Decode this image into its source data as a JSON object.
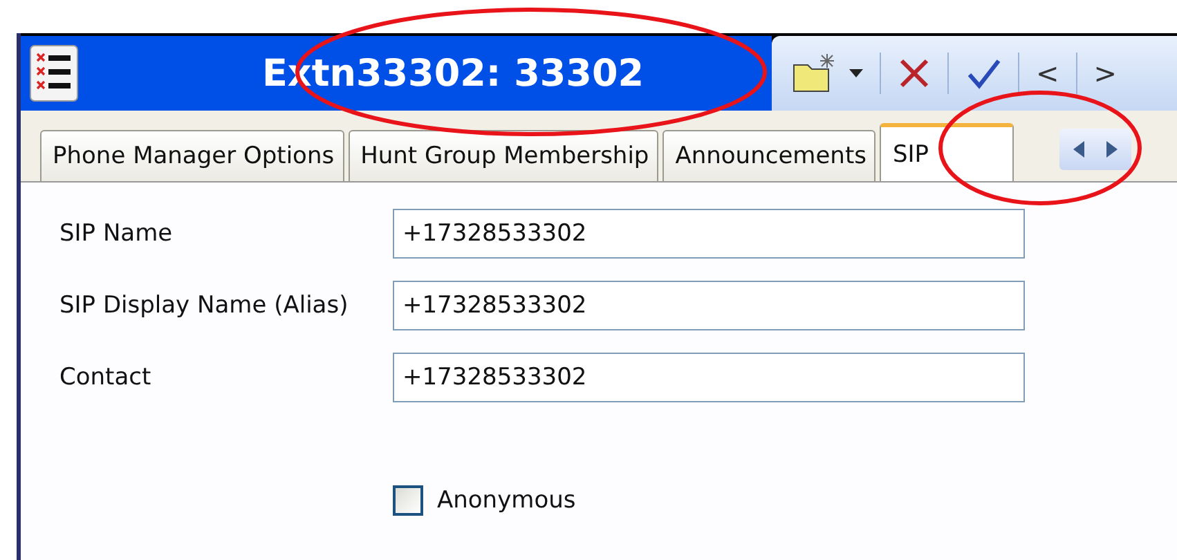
{
  "window": {
    "title": "Extn33302: 33302"
  },
  "toolbar": {
    "prev": "<",
    "next": ">"
  },
  "tabs": [
    {
      "label": "Phone Manager Options",
      "selected": false
    },
    {
      "label": "Hunt Group Membership",
      "selected": false
    },
    {
      "label": "Announcements",
      "selected": false
    },
    {
      "label": "SIP",
      "selected": true
    }
  ],
  "fields": [
    {
      "label": "SIP Name",
      "value": "+17328533302"
    },
    {
      "label": "SIP Display Name (Alias)",
      "value": "+17328533302"
    },
    {
      "label": "Contact",
      "value": "+17328533302"
    }
  ],
  "anonymous": {
    "label": "Anonymous",
    "checked": false
  }
}
